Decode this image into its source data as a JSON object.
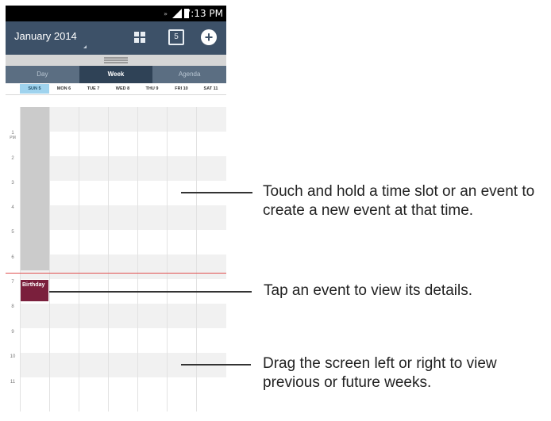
{
  "status_bar": {
    "time": "7:13 PM",
    "network_icon": "signal-icon",
    "battery_icon": "battery-icon"
  },
  "action_bar": {
    "month_label": "January 2014",
    "month_icon": "dropdown-caret-icon",
    "grid_icon": "calendar-grid-icon",
    "today_icon": "today-icon",
    "today_icon_text": "5",
    "add_icon": "add-event-icon",
    "add_icon_text": "+"
  },
  "view_tabs": [
    {
      "label": "Day",
      "active": false
    },
    {
      "label": "Week",
      "active": true
    },
    {
      "label": "Agenda",
      "active": false
    }
  ],
  "week_days": [
    {
      "label": "SUN 5",
      "today": true
    },
    {
      "label": "MON 6",
      "today": false
    },
    {
      "label": "TUE 7",
      "today": false
    },
    {
      "label": "WED 8",
      "today": false
    },
    {
      "label": "THU 9",
      "today": false
    },
    {
      "label": "FRI 10",
      "today": false
    },
    {
      "label": "SAT 11",
      "today": false
    }
  ],
  "hours": [
    {
      "label": "1",
      "sublabel": "PM"
    },
    {
      "label": "2"
    },
    {
      "label": "3"
    },
    {
      "label": "4"
    },
    {
      "label": "5"
    },
    {
      "label": "6"
    },
    {
      "label": "7"
    },
    {
      "label": "8"
    },
    {
      "label": "9"
    },
    {
      "label": "10"
    },
    {
      "label": "11"
    }
  ],
  "event": {
    "title": "Birthday",
    "day": "SUN 5",
    "hour": "7"
  },
  "callouts": [
    {
      "text": "Touch and hold a time slot or an event to create a new event at that time."
    },
    {
      "text": "Tap an event to view its details."
    },
    {
      "text": "Drag the screen left or right to view previous or future weeks."
    }
  ],
  "colors": {
    "action_bar": "#3d5168",
    "tab_bar": "#5b6e82",
    "active_tab": "#2f4256",
    "today_header": "#9fd3ee",
    "event": "#7a1f3c",
    "now_line": "#e05050"
  }
}
